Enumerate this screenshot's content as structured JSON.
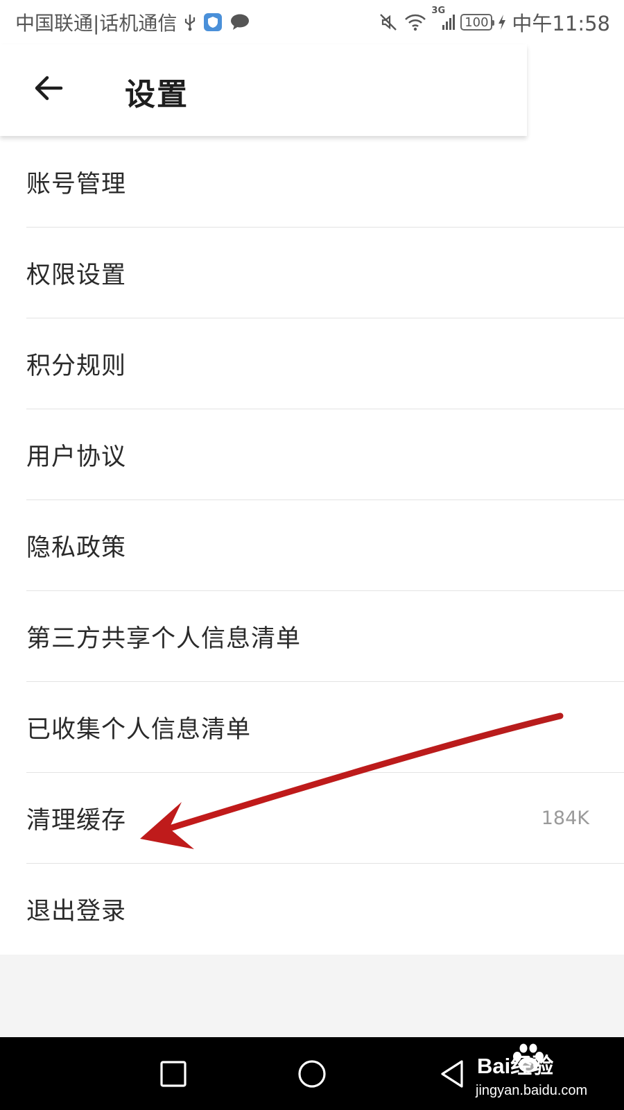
{
  "status_bar": {
    "carrier": "中国联通|话机通信",
    "network_type": "3G",
    "battery": "100",
    "time": "中午11:58",
    "icons_left": [
      "usb-icon",
      "shield-app-icon",
      "message-icon"
    ],
    "icons_right": [
      "mute-icon",
      "wifi-icon",
      "signal-icon",
      "battery-icon",
      "charging-icon"
    ]
  },
  "header": {
    "title": "设置",
    "back_icon": "arrow-left-icon"
  },
  "settings": {
    "items": [
      {
        "label": "账号管理"
      },
      {
        "label": "权限设置"
      },
      {
        "label": "积分规则"
      },
      {
        "label": "用户协议"
      },
      {
        "label": "隐私政策"
      },
      {
        "label": "第三方共享个人信息清单"
      },
      {
        "label": "已收集个人信息清单"
      },
      {
        "label": "清理缓存",
        "value": "184K"
      },
      {
        "label": "退出登录"
      }
    ]
  },
  "annotation": {
    "type": "arrow",
    "color": "#c62828",
    "target": "清理缓存"
  },
  "nav_bar": {
    "buttons": [
      "recent-apps-icon",
      "home-icon",
      "back-triangle-icon"
    ]
  },
  "watermark": {
    "brand": "Bai经验",
    "url": "jingyan.baidu.com"
  },
  "colors": {
    "background": "#ffffff",
    "divider": "#e3e3e3",
    "value_text": "#9a9a9a",
    "nav_bar": "#000000"
  }
}
